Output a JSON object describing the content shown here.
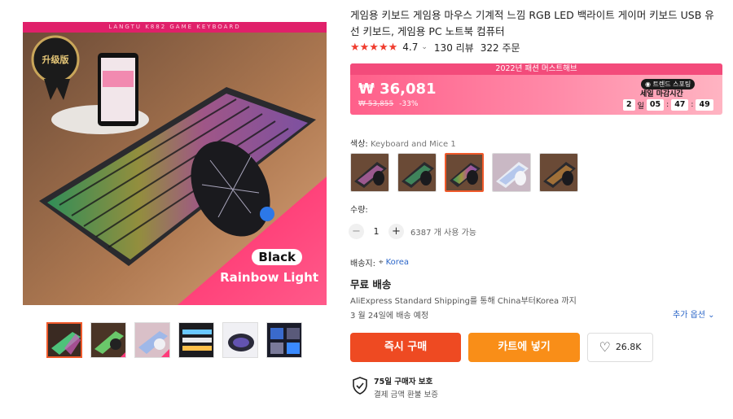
{
  "product": {
    "title": "게임용 키보드 게임용 마우스 기계적 느낌 RGB LED 백라이트 게이머 키보드 USB 유선 키보드, 게임용 PC 노트북 컴퓨터",
    "rating": "4.7",
    "reviews": "130 리뷰",
    "orders": "322 주문"
  },
  "gallery": {
    "banner_text": "LANGTU K882 GAME KEYBOARD",
    "seal_text": "升级版",
    "variant_line1": "Black",
    "variant_line2": "Rainbow Light",
    "thumbnail_count": 6
  },
  "promo": {
    "header": "2022년 패션 머스트해브",
    "price": "₩ 36,081",
    "original_price": "₩ 53,855",
    "discount": "-33%",
    "trend_badge": "트렌드 스포팅",
    "sale_end_label": "세일 마감시간",
    "timer": {
      "days": "2",
      "day_unit": "일",
      "hours": "05",
      "minutes": "47",
      "seconds": "49"
    }
  },
  "color": {
    "label": "색상:",
    "value": "Keyboard and Mice 1",
    "selected_index": 2,
    "option_count": 5
  },
  "quantity": {
    "label": "수량:",
    "value": "1",
    "minus": "−",
    "plus": "+",
    "available": "6387 개 사용 가능"
  },
  "shipping": {
    "ship_to_label": "배송지:",
    "ship_to_country": "Korea",
    "free_shipping": "무료 배송",
    "via": "AliExpress Standard Shipping를 통해 China부터Korea 까지",
    "delivery_date": "3 월 24일에 배송 예정",
    "more_options": "추가 옵션"
  },
  "actions": {
    "buy_now": "즉시 구매",
    "add_to_cart": "카트에 넣기",
    "wishlist_count": "26.8K"
  },
  "protection": {
    "title": "75일 구매자 보호",
    "subtitle": "결제 금액 환불 보증"
  },
  "colors": {
    "accent_red": "#ee4a22",
    "accent_orange": "#f98e18",
    "star_red": "#f03c2e",
    "link_blue": "#2b66c8",
    "promo_pink": "#ff5f8a"
  },
  "icons": {
    "star": "star-icon",
    "pin": "location-pin-icon",
    "heart": "heart-icon",
    "shield": "shield-check-icon",
    "chevron": "chevron-down-icon"
  }
}
